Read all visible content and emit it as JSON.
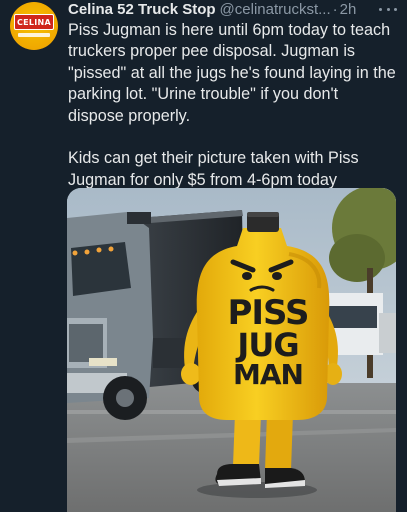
{
  "tweet": {
    "display_name": "Celina 52 Truck Stop",
    "handle": "@celinatruckst...",
    "separator": "·",
    "time": "2h",
    "paragraphs": [
      "Piss Jugman is here until 6pm today to teach truckers proper pee disposal. Jugman is \"pissed\" at all the jugs he's found laying in the parking lot. \"Urine trouble\" if you don't dispose properly.",
      "Kids can get their picture taken with Piss Jugman for only $5 from 4-6pm today"
    ]
  },
  "avatar": {
    "logo_text": "CELINA"
  },
  "media": {
    "jug_label_lines": [
      "PISS",
      "JUG",
      "MAN"
    ]
  },
  "colors": {
    "background": "#15202b",
    "text_primary": "#e7e9ea",
    "text_secondary": "#8b98a5",
    "jug_yellow": "#f5c518"
  },
  "icons": {
    "more": "more-horizontal-icon"
  }
}
